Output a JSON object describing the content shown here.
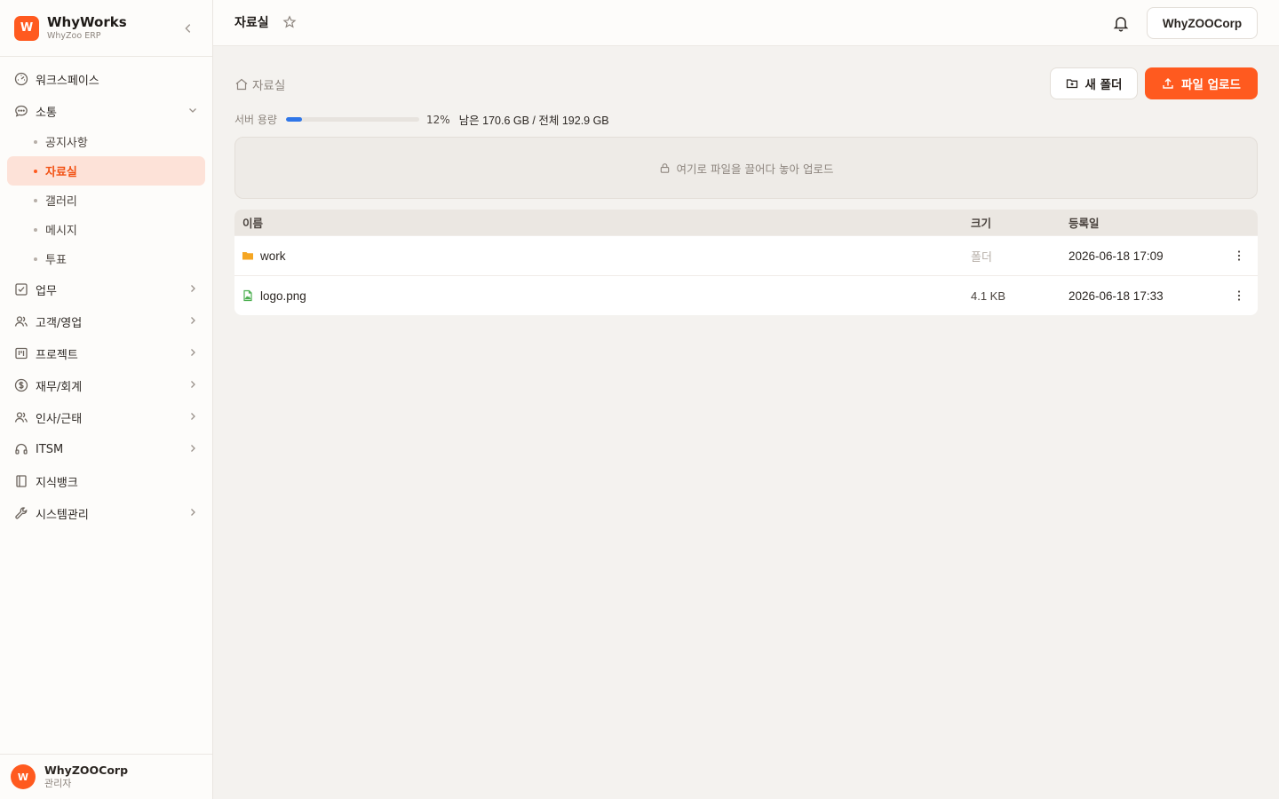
{
  "brand": {
    "name": "WhyWorks",
    "subtitle": "WhyZoo ERP",
    "logo_letter": "W"
  },
  "nav": {
    "workspace": "워크스페이스",
    "communication": "소통",
    "sub": [
      "공지사항",
      "자료실",
      "갤러리",
      "메시지",
      "투표"
    ],
    "tasks": "업무",
    "customers": "고객/영업",
    "projects": "프로젝트",
    "finance": "재무/회계",
    "hr": "인사/근태",
    "itsm": "ITSM",
    "knowledge": "지식뱅크",
    "system": "시스템관리"
  },
  "user": {
    "avatar": "W",
    "name": "WhyZOOCorp",
    "role": "관리자"
  },
  "topbar": {
    "title": "자료실",
    "org": "WhyZOOCorp"
  },
  "breadcrumb": "자료실",
  "buttons": {
    "new_folder": "새 폴더",
    "upload": "파일 업로드"
  },
  "storage": {
    "label": "서버 용량",
    "percent": 12,
    "percent_text": "12%",
    "detail": "남은 170.6 GB / 전체 192.9 GB"
  },
  "dropzone": "여기로 파일을 끌어다 놓아 업로드",
  "table": {
    "headers": {
      "name": "이름",
      "size": "크기",
      "date": "등록일"
    },
    "rows": [
      {
        "name": "work",
        "size": "폴더",
        "date": "2026-06-18 17:09",
        "type": "folder"
      },
      {
        "name": "logo.png",
        "size": "4.1 KB",
        "date": "2026-06-18 17:33",
        "type": "image"
      }
    ]
  },
  "colors": {
    "accent": "#ff5a1f",
    "active_bg": "#fde2d8",
    "progress": "#2f76e8",
    "folder": "#f5a623",
    "image_file": "#4caf50"
  }
}
